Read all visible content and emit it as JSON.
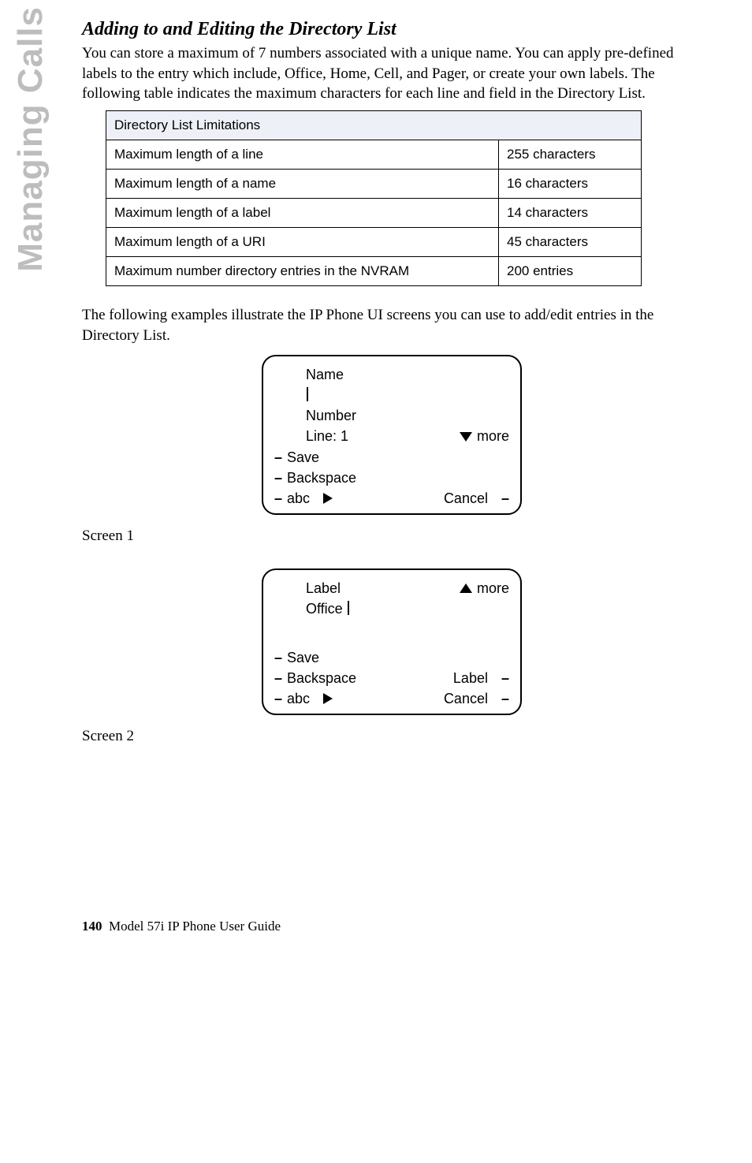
{
  "sideTab": "Managing Calls",
  "sectionTitle": "Adding to and Editing the Directory List",
  "intro": "You can store a maximum of 7 numbers associated with a unique name. You can apply pre-defined labels to the entry which include, Office, Home, Cell, and Pager, or create your own labels. The following table indicates the maximum characters for each line and field in the Directory List.",
  "table": {
    "header": "Directory List Limitations",
    "rows": [
      {
        "left": "Maximum length of a line",
        "right": "255 characters"
      },
      {
        "left": "Maximum length of a name",
        "right": "16 characters"
      },
      {
        "left": "Maximum length of a label",
        "right": "14 characters"
      },
      {
        "left": "Maximum length of a URI",
        "right": "45 characters"
      },
      {
        "left": "Maximum number directory entries in the NVRAM",
        "right": "200 entries"
      }
    ]
  },
  "afterTable": "The following examples illustrate the IP Phone UI screens you can use to add/edit entries in the Directory List.",
  "screen1": {
    "lines": {
      "name": "Name",
      "number": "Number",
      "line": "Line: 1",
      "more": "more",
      "save": "Save",
      "backspace": "Backspace",
      "abc": "abc",
      "cancel": "Cancel"
    },
    "caption": "Screen 1"
  },
  "screen2": {
    "lines": {
      "label": "Label",
      "office": "Office",
      "more": "more",
      "save": "Save",
      "backspace": "Backspace",
      "labelKey": "Label",
      "abc": "abc",
      "cancel": "Cancel"
    },
    "caption": "Screen 2"
  },
  "footer": {
    "page": "140",
    "title": "Model 57i IP Phone User Guide"
  }
}
